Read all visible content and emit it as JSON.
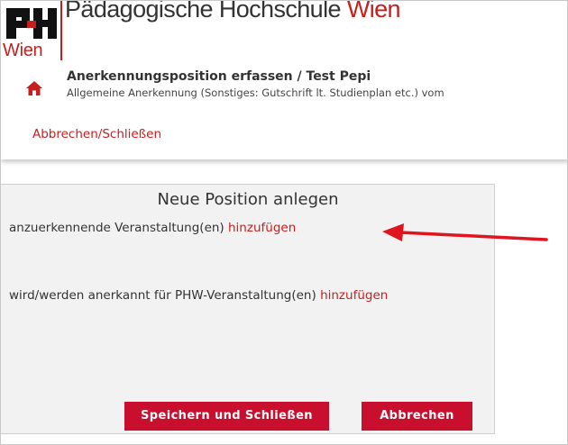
{
  "header": {
    "logo_text": "Wien",
    "institution_prefix": "Pädagogische Hochschule ",
    "institution_accent": "Wien",
    "page_title": "Anerkennungsposition erfassen  / Test Pepi",
    "page_subtitle": "Allgemeine Anerkennung (Sonstiges: Gutschrift lt. Studienplan etc.) vom",
    "cancel_link": "Abbrechen/Schließen",
    "home_icon": "home-icon"
  },
  "dialog": {
    "title": "Neue Position anlegen",
    "row1_text": "anzuerkennende Veranstaltung(en) ",
    "row1_link": "hinzufügen",
    "row2_text": "wird/werden anerkannt für PHW-Veranstaltung(en) ",
    "row2_link": "hinzufügen",
    "save_button": "Speichern und Schließen",
    "cancel_button": "Abbrechen"
  },
  "annotation": {
    "arrow_icon": "arrow-left-icon",
    "color": "#e0141e"
  },
  "colors": {
    "brand_red": "#c81e1e",
    "button_red": "#c8102e",
    "panel_bg": "#f2f2f2"
  }
}
